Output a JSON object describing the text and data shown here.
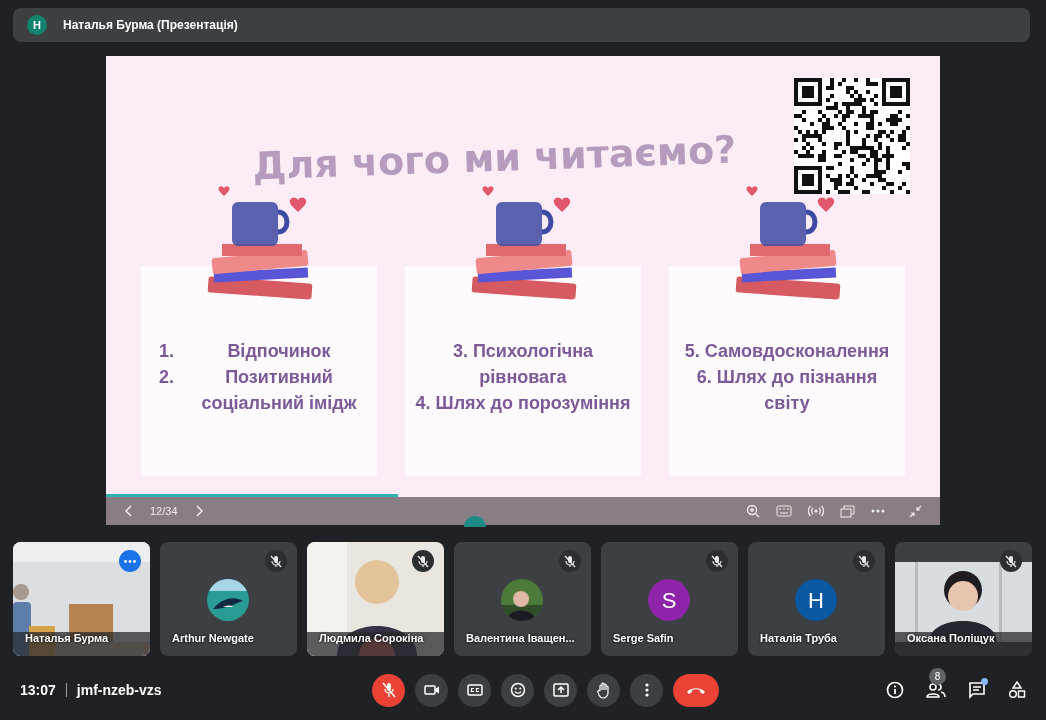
{
  "presentation_bar": {
    "avatar_letter": "Н",
    "title": "Наталья Бурма (Презентація)"
  },
  "slide": {
    "title": "Для чого ми читаємо?",
    "cards": [
      {
        "kind": "numbered",
        "items": [
          {
            "number": "1.",
            "text": "Відпочинок"
          },
          {
            "number": "2.",
            "text": "Позитивний соціальний імідж"
          }
        ]
      },
      {
        "kind": "plain",
        "items": [
          {
            "text": "3. Психологічна рівновага"
          },
          {
            "text": "4. Шлях до порозуміння"
          }
        ]
      },
      {
        "kind": "plain",
        "items": [
          {
            "text": "5. Самовдосконалення"
          },
          {
            "text": "6. Шлях до пізнання світу"
          }
        ]
      }
    ]
  },
  "slide_controls": {
    "page": "12/34",
    "level": 0.35
  },
  "participants": [
    {
      "name": "Наталья Бурма",
      "kind": "video",
      "selected": true,
      "muted": false
    },
    {
      "name": "Arthur Newgate",
      "kind": "photo_avatar",
      "selected": false,
      "muted": true
    },
    {
      "name": "Людмила Сорокіна",
      "kind": "video",
      "selected": false,
      "muted": true
    },
    {
      "name": "Валентина Іващен...",
      "kind": "photo_avatar",
      "selected": false,
      "muted": true
    },
    {
      "name": "Serge Safin",
      "kind": "letter",
      "letter": "S",
      "color": "#8e24aa",
      "selected": false,
      "muted": true
    },
    {
      "name": "Наталія Труба",
      "kind": "letter",
      "letter": "Н",
      "color": "#0b57a0",
      "selected": false,
      "muted": true
    },
    {
      "name": "Оксана Поліщук",
      "kind": "video",
      "selected": false,
      "muted": true
    }
  ],
  "toolbar": {
    "time": "13:07",
    "meeting_code": "jmf-nzeb-vzs",
    "mic_on": false,
    "people_count": "8",
    "chat_unread": true
  }
}
